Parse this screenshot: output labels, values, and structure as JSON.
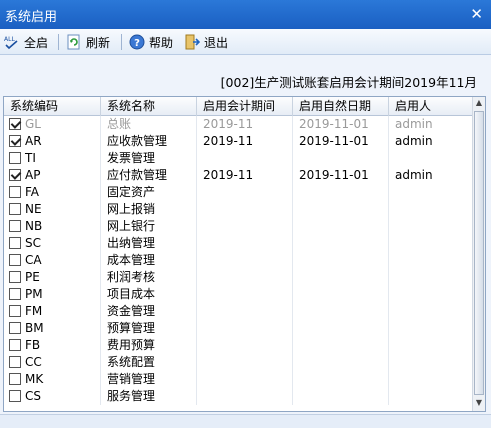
{
  "window": {
    "title": "系统启用"
  },
  "toolbar": {
    "select_all": "全启",
    "refresh": "刷新",
    "help": "帮助",
    "exit": "退出"
  },
  "heading": "[002]生产测试账套启用会计期间2019年11月",
  "table": {
    "columns": [
      "系统编码",
      "系统名称",
      "启用会计期间",
      "启用自然日期",
      "启用人"
    ],
    "rows": [
      {
        "code": "GL",
        "name": "总账",
        "period": "2019-11",
        "date": "2019-11-01",
        "user": "admin",
        "checked": true,
        "disabled": true
      },
      {
        "code": "AR",
        "name": "应收款管理",
        "period": "2019-11",
        "date": "2019-11-01",
        "user": "admin",
        "checked": true,
        "disabled": false
      },
      {
        "code": "TI",
        "name": "发票管理",
        "period": "",
        "date": "",
        "user": "",
        "checked": false,
        "disabled": false
      },
      {
        "code": "AP",
        "name": "应付款管理",
        "period": "2019-11",
        "date": "2019-11-01",
        "user": "admin",
        "checked": true,
        "disabled": false
      },
      {
        "code": "FA",
        "name": "固定资产",
        "period": "",
        "date": "",
        "user": "",
        "checked": false,
        "disabled": false
      },
      {
        "code": "NE",
        "name": "网上报销",
        "period": "",
        "date": "",
        "user": "",
        "checked": false,
        "disabled": false
      },
      {
        "code": "NB",
        "name": "网上银行",
        "period": "",
        "date": "",
        "user": "",
        "checked": false,
        "disabled": false
      },
      {
        "code": "SC",
        "name": "出纳管理",
        "period": "",
        "date": "",
        "user": "",
        "checked": false,
        "disabled": false
      },
      {
        "code": "CA",
        "name": "成本管理",
        "period": "",
        "date": "",
        "user": "",
        "checked": false,
        "disabled": false
      },
      {
        "code": "PE",
        "name": "利润考核",
        "period": "",
        "date": "",
        "user": "",
        "checked": false,
        "disabled": false
      },
      {
        "code": "PM",
        "name": "项目成本",
        "period": "",
        "date": "",
        "user": "",
        "checked": false,
        "disabled": false
      },
      {
        "code": "FM",
        "name": "资金管理",
        "period": "",
        "date": "",
        "user": "",
        "checked": false,
        "disabled": false
      },
      {
        "code": "BM",
        "name": "预算管理",
        "period": "",
        "date": "",
        "user": "",
        "checked": false,
        "disabled": false
      },
      {
        "code": "FB",
        "name": "费用预算",
        "period": "",
        "date": "",
        "user": "",
        "checked": false,
        "disabled": false
      },
      {
        "code": "CC",
        "name": "系统配置",
        "period": "",
        "date": "",
        "user": "",
        "checked": false,
        "disabled": false
      },
      {
        "code": "MK",
        "name": "营销管理",
        "period": "",
        "date": "",
        "user": "",
        "checked": false,
        "disabled": false
      },
      {
        "code": "CS",
        "name": "服务管理",
        "period": "",
        "date": "",
        "user": "",
        "checked": false,
        "disabled": false
      }
    ]
  },
  "icons": {
    "select_all": "select-all-icon",
    "refresh": "refresh-icon",
    "help": "help-icon",
    "exit": "exit-icon",
    "close": "close-icon"
  }
}
